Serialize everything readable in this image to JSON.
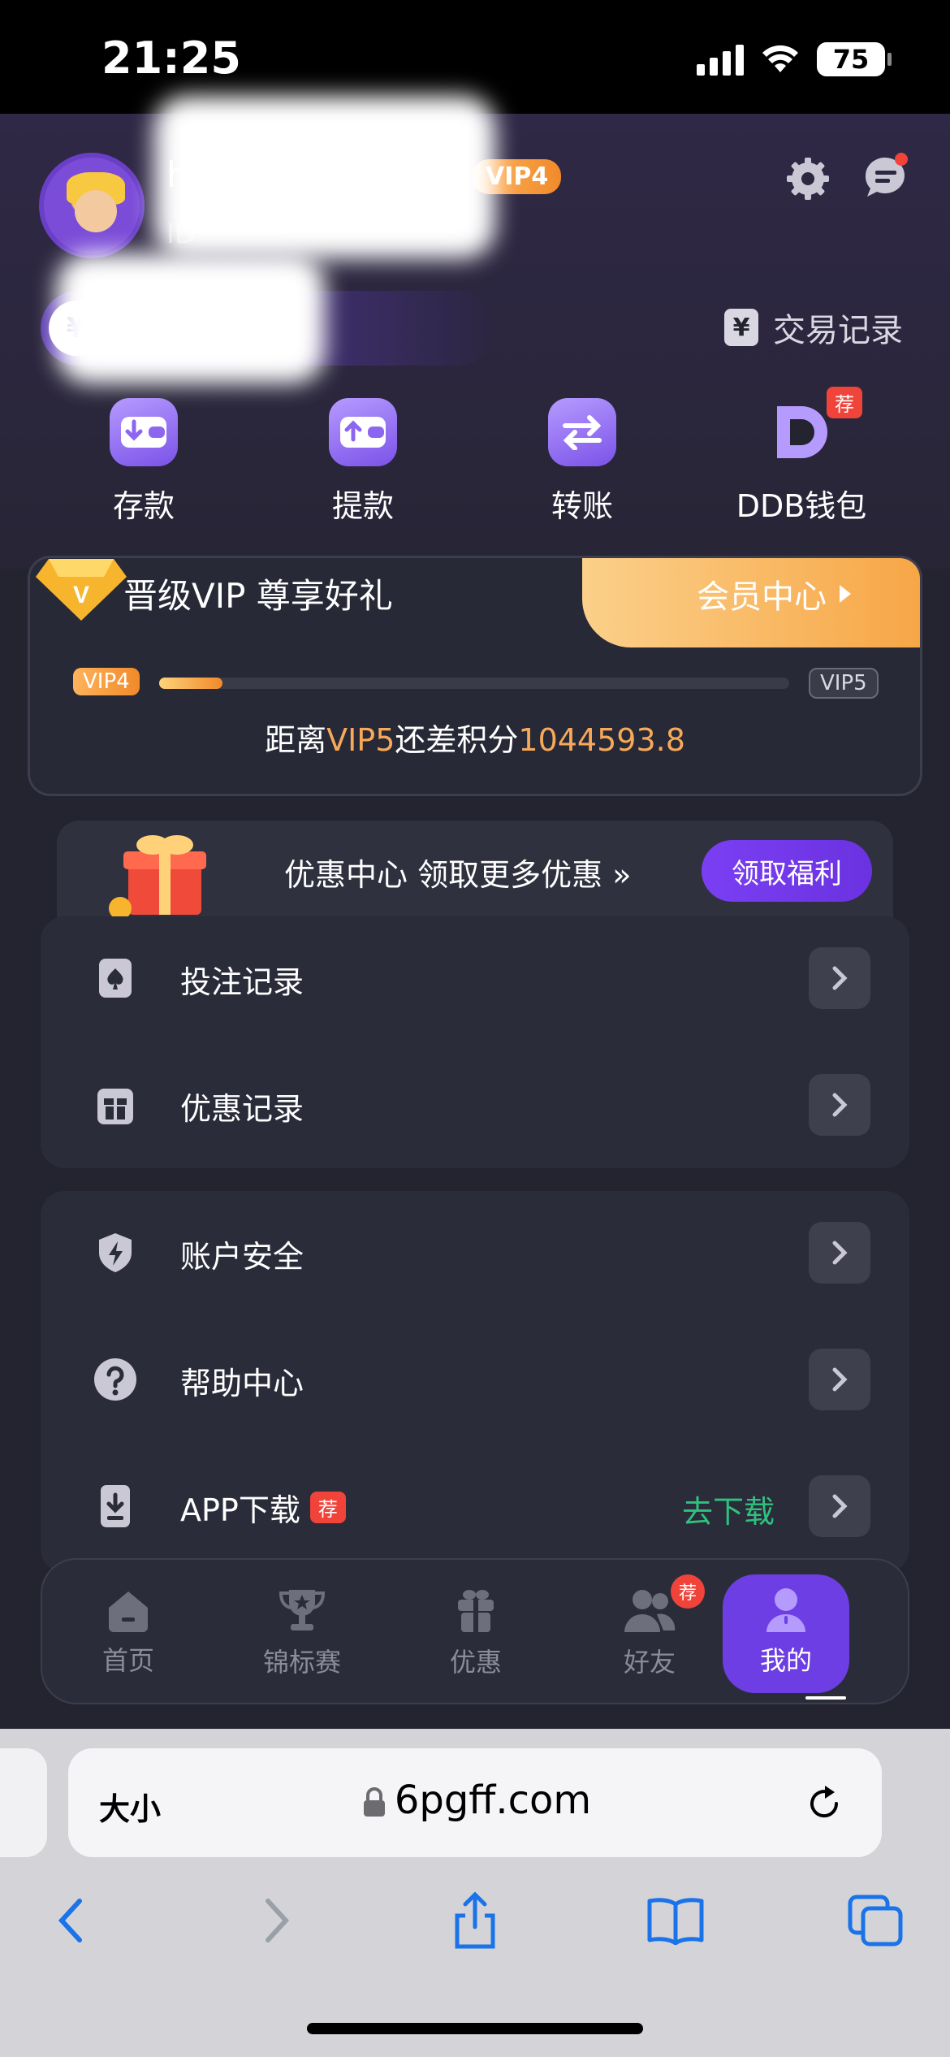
{
  "status_bar": {
    "time": "21:25",
    "battery": "75"
  },
  "profile": {
    "name": "h",
    "vip_badge": "VIP4",
    "id_label": "ID",
    "balance_symbol": "¥"
  },
  "header": {
    "transaction_records": "交易记录"
  },
  "quick_actions": [
    {
      "label": "存款",
      "icon": "deposit-wallet-icon"
    },
    {
      "label": "提款",
      "icon": "withdraw-wallet-icon"
    },
    {
      "label": "转账",
      "icon": "transfer-arrows-icon"
    },
    {
      "label": "DDB钱包",
      "icon": "ddb-wallet-icon",
      "badge": "荐"
    }
  ],
  "vip": {
    "title": "晋级VIP 尊享好礼",
    "member_center": "会员中心",
    "from_level": "VIP4",
    "to_level": "VIP5",
    "progress": 0.1,
    "distance_prefix": "距离",
    "distance_level": "VIP5",
    "distance_mid": "还差积分",
    "distance_points": "1044593.8"
  },
  "promo": {
    "text": "优惠中心 领取更多优惠",
    "button": "领取福利"
  },
  "menu_group_1": [
    {
      "label": "投注记录",
      "icon": "spade-card-icon"
    },
    {
      "label": "优惠记录",
      "icon": "gift-box-icon"
    }
  ],
  "menu_group_2": [
    {
      "label": "账户安全",
      "icon": "shield-bolt-icon"
    },
    {
      "label": "帮助中心",
      "icon": "question-circle-icon"
    },
    {
      "label": "APP下载",
      "icon": "phone-download-icon",
      "badge": "荐",
      "action_text": "去下载"
    }
  ],
  "bottom_nav": [
    {
      "label": "首页",
      "icon": "home-icon"
    },
    {
      "label": "锦标赛",
      "icon": "trophy-icon"
    },
    {
      "label": "优惠",
      "icon": "gift-icon"
    },
    {
      "label": "好友",
      "icon": "friends-icon",
      "badge": "荐"
    },
    {
      "label": "我的",
      "icon": "user-icon",
      "active": true
    }
  ],
  "browser": {
    "text_size": "大小",
    "url": "6pgff.com"
  },
  "colors": {
    "accent_purple": "#6c3ee3",
    "vip_orange": "#f7a959",
    "download_green": "#2ec27e"
  }
}
